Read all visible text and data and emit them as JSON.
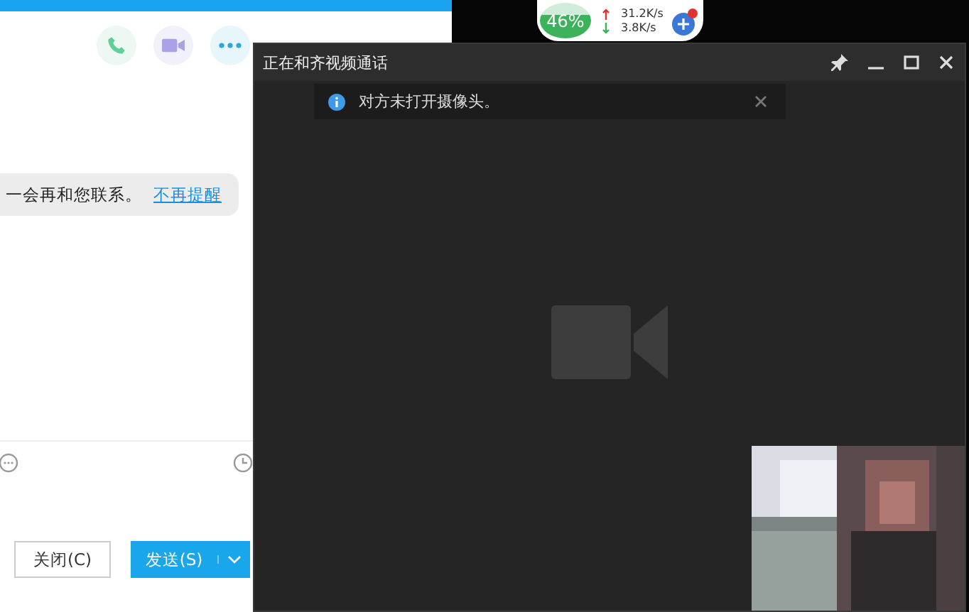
{
  "chat_window": {
    "call_buttons": [
      {
        "kind": "phone"
      },
      {
        "kind": "video"
      },
      {
        "kind": "more"
      }
    ],
    "message": {
      "text": "一会再和您联系。",
      "link": "不再提醒"
    },
    "tools": [
      {
        "kind": "emoji"
      },
      {
        "kind": "history"
      }
    ],
    "close_button": "关闭(C)",
    "send_button": "发送(S)"
  },
  "speed_widget": {
    "percent": "46%",
    "upload": "31.2K/s",
    "download": "3.8K/s",
    "notification_dot": true
  },
  "video_window": {
    "title": "正在和齐视频通话",
    "notice": "对方未打开摄像头。",
    "camera_off": true
  }
}
